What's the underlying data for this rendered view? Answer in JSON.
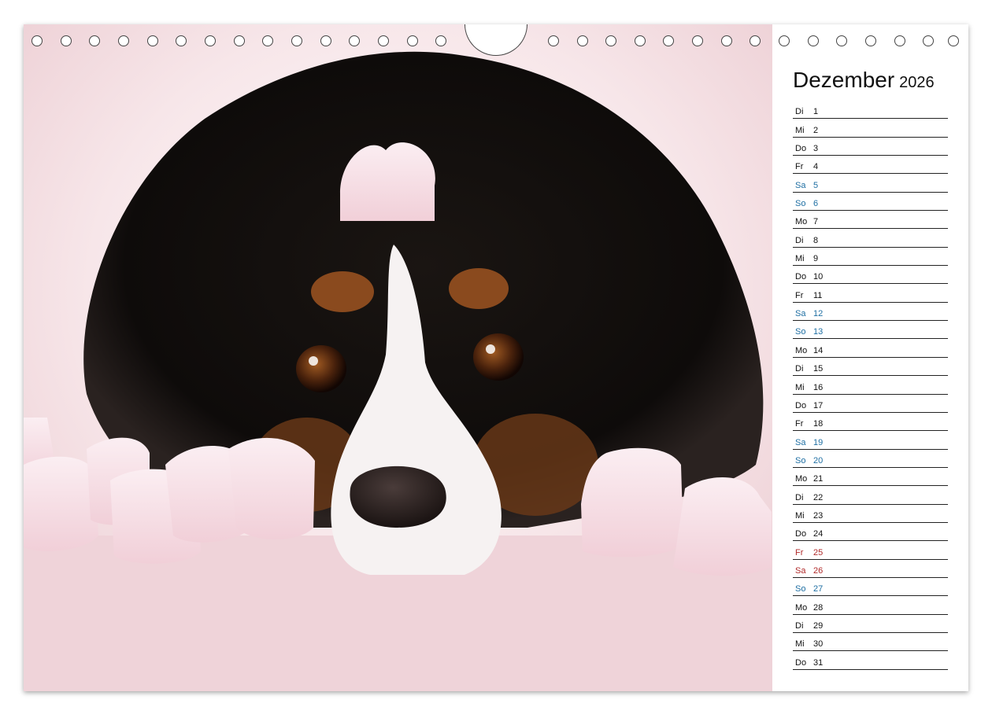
{
  "calendar": {
    "month": "Dezember",
    "year": "2026",
    "colors": {
      "weekday": "#111111",
      "weekend": "#1f6fa3",
      "holiday": "#b02a2a"
    },
    "days": [
      {
        "weekday": "Di",
        "date": "1",
        "type": "weekday"
      },
      {
        "weekday": "Mi",
        "date": "2",
        "type": "weekday"
      },
      {
        "weekday": "Do",
        "date": "3",
        "type": "weekday"
      },
      {
        "weekday": "Fr",
        "date": "4",
        "type": "weekday"
      },
      {
        "weekday": "Sa",
        "date": "5",
        "type": "weekend"
      },
      {
        "weekday": "So",
        "date": "6",
        "type": "weekend"
      },
      {
        "weekday": "Mo",
        "date": "7",
        "type": "weekday"
      },
      {
        "weekday": "Di",
        "date": "8",
        "type": "weekday"
      },
      {
        "weekday": "Mi",
        "date": "9",
        "type": "weekday"
      },
      {
        "weekday": "Do",
        "date": "10",
        "type": "weekday"
      },
      {
        "weekday": "Fr",
        "date": "11",
        "type": "weekday"
      },
      {
        "weekday": "Sa",
        "date": "12",
        "type": "weekend"
      },
      {
        "weekday": "So",
        "date": "13",
        "type": "weekend"
      },
      {
        "weekday": "Mo",
        "date": "14",
        "type": "weekday"
      },
      {
        "weekday": "Di",
        "date": "15",
        "type": "weekday"
      },
      {
        "weekday": "Mi",
        "date": "16",
        "type": "weekday"
      },
      {
        "weekday": "Do",
        "date": "17",
        "type": "weekday"
      },
      {
        "weekday": "Fr",
        "date": "18",
        "type": "weekday"
      },
      {
        "weekday": "Sa",
        "date": "19",
        "type": "weekend"
      },
      {
        "weekday": "So",
        "date": "20",
        "type": "weekend"
      },
      {
        "weekday": "Mo",
        "date": "21",
        "type": "weekday"
      },
      {
        "weekday": "Di",
        "date": "22",
        "type": "weekday"
      },
      {
        "weekday": "Mi",
        "date": "23",
        "type": "weekday"
      },
      {
        "weekday": "Do",
        "date": "24",
        "type": "weekday"
      },
      {
        "weekday": "Fr",
        "date": "25",
        "type": "holiday"
      },
      {
        "weekday": "Sa",
        "date": "26",
        "type": "holiday"
      },
      {
        "weekday": "So",
        "date": "27",
        "type": "weekend"
      },
      {
        "weekday": "Mo",
        "date": "28",
        "type": "weekday"
      },
      {
        "weekday": "Di",
        "date": "29",
        "type": "weekday"
      },
      {
        "weekday": "Mi",
        "date": "30",
        "type": "weekday"
      },
      {
        "weekday": "Do",
        "date": "31",
        "type": "weekday"
      }
    ]
  },
  "photo": {
    "subject": "dog-with-marshmallows",
    "background_color": "#f2d6db"
  }
}
